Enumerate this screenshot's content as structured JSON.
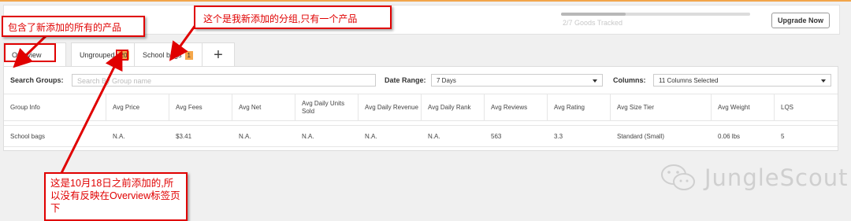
{
  "header": {
    "progress_text": "2/7 Goods Tracked",
    "progress_fraction": 0.34,
    "upgrade_label": "Upgrade Now"
  },
  "tabs": [
    {
      "label": "Overview"
    },
    {
      "label": "Ungrouped",
      "badge": "20"
    },
    {
      "label": "School bags",
      "badge": "1"
    }
  ],
  "add_tab_symbol": "+",
  "filters": {
    "search_label": "Search Groups:",
    "search_placeholder": "Search By Group name",
    "date_label": "Date Range:",
    "date_value": "7 Days",
    "columns_label": "Columns:",
    "columns_value": "11 Columns Selected"
  },
  "table": {
    "headers": [
      "Group Info",
      "Avg Price",
      "Avg Fees",
      "Avg Net",
      "Avg Daily Units Sold",
      "Avg Daily Revenue",
      "Avg Daily Rank",
      "Avg Reviews",
      "Avg Rating",
      "Avg Size Tier",
      "Avg Weight",
      "LQS"
    ],
    "rows": [
      [
        "School bags",
        "N.A.",
        "$3.41",
        "N.A.",
        "N.A.",
        "N.A.",
        "N.A.",
        "563",
        "3.3",
        "Standard (Small)",
        "0.06 lbs",
        "5"
      ]
    ]
  },
  "annotations": {
    "callout_1": "包含了新添加的所有的产品",
    "callout_2": "这个是我新添加的分组,只有一个产品",
    "callout_3": "这是10月18日之前添加的,所以没有反映在Overview标签页下"
  },
  "watermark": "JungleScout",
  "colors": {
    "accent": "#f5a74a",
    "annotation_red": "#e00000"
  }
}
